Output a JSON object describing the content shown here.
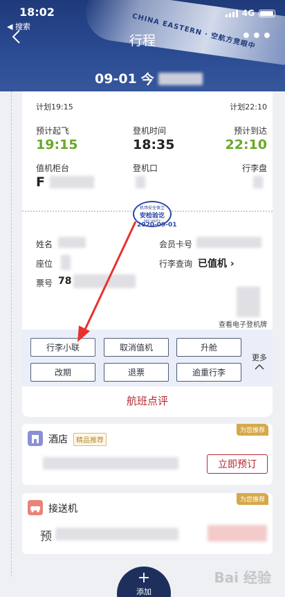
{
  "status_bar": {
    "time": "18:02",
    "back_app": "◀ 搜索",
    "network": "4G"
  },
  "nav": {
    "title": "行程",
    "more": "•••"
  },
  "header": {
    "flight_date": "09-01",
    "flight_prefix": "今",
    "plane_livery": "CHINA EASTERN · 空航方竞眼中"
  },
  "flight": {
    "planned_dep": "计划19:15",
    "planned_arr": "计划22:10",
    "dep_label": "预计起飞",
    "dep_time": "19:15",
    "board_label": "登机时间",
    "board_time": "18:35",
    "arr_label": "预计到达",
    "arr_time": "22:10",
    "checkin_counter_label": "值机柜台",
    "checkin_counter_value": "F",
    "gate_label": "登机口",
    "baggage_label": "行李盘"
  },
  "stamp": {
    "line1": "机场安全保卫",
    "line2": "安检验讫",
    "line3": "SECURITY",
    "date": "2020-09-01"
  },
  "passenger": {
    "name_label": "姓名",
    "member_label": "会员卡号",
    "seat_label": "座位",
    "baggage_query_label": "行李查询",
    "baggage_query_value": "已值机 ›",
    "ticket_label": "票号",
    "ticket_prefix": "78",
    "boarding_pass_link": "查看电子登机牌"
  },
  "actions": {
    "baggage_tag": "行李小联",
    "cancel_checkin": "取消值机",
    "upgrade": "升舱",
    "reschedule": "改期",
    "refund": "退票",
    "overweight": "逾重行李",
    "more": "更多"
  },
  "review": "航班点评",
  "hotel": {
    "title": "酒店",
    "tag": "精品推荐",
    "recommend": "为您推荐",
    "book_button": "立即预订"
  },
  "transfer": {
    "title": "接送机",
    "recommend": "为您推荐",
    "prefix": "预"
  },
  "add": {
    "label": "添加",
    "plus": "+"
  },
  "watermark": "Bai 经验",
  "colors": {
    "header_blue": "#1f3a7a",
    "accent_green": "#6aa828",
    "accent_red": "#b7262f",
    "arrow_red": "#e8322d"
  }
}
